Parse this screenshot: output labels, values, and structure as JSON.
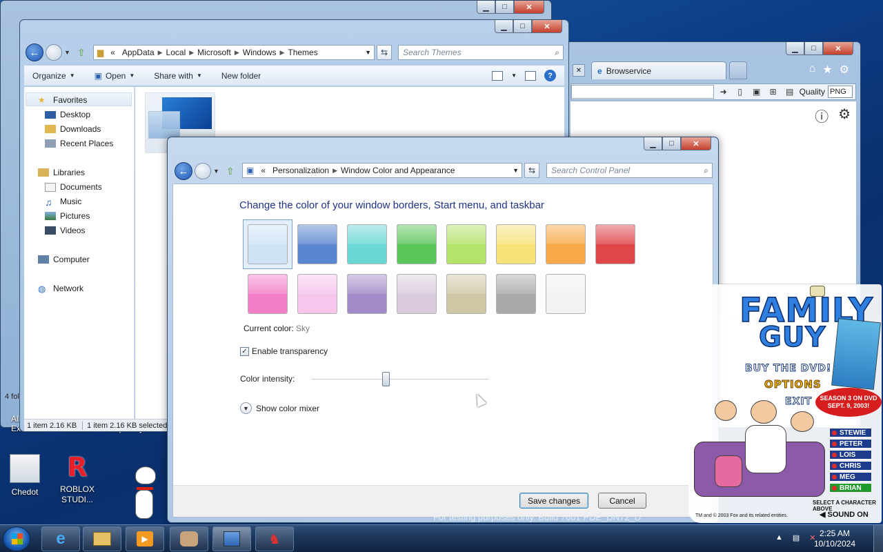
{
  "explorer": {
    "breadcrumb": [
      "AppData",
      "Local",
      "Microsoft",
      "Windows",
      "Themes"
    ],
    "search_placeholder": "Search Themes",
    "commands": [
      "Organize",
      "Open",
      "Share with",
      "New folder"
    ],
    "nav": {
      "favorites": "Favorites",
      "desktop": "Desktop",
      "downloads": "Downloads",
      "recent": "Recent Places",
      "libraries": "Libraries",
      "documents": "Documents",
      "music": "Music",
      "pictures": "Pictures",
      "videos": "Videos",
      "computer": "Computer",
      "network": "Network"
    },
    "status_left": "1 item 2.16 KB",
    "status_right": "1 item 2.16 KB selected"
  },
  "back_window": {
    "status_fragment": "4 fol"
  },
  "browser": {
    "tab_title": "Browservice",
    "quality_label": "Quality",
    "quality_value": "PNG"
  },
  "control_panel": {
    "breadcrumb": [
      "Personalization",
      "Window Color and Appearance"
    ],
    "search_placeholder": "Search Control Panel",
    "heading": "Change the color of your window borders, Start menu, and taskbar",
    "swatches_row1": [
      "#cfe3f7",
      "#5a86cf",
      "#6ad8d4",
      "#5cc55a",
      "#b4e36a",
      "#f7e27a",
      "#f8aa4a",
      "#e0454a"
    ],
    "swatches_row2": [
      "#f27ec7",
      "#f6c6ec",
      "#a28ac8",
      "#d9cbdd",
      "#cfc6a6",
      "#a9a9a9",
      "#f2f2f2"
    ],
    "current_color_label": "Current color:",
    "current_color_value": "Sky",
    "transparency_label": "Enable transparency",
    "transparency_checked": "✓",
    "intensity_label": "Color intensity:",
    "intensity_value": 0.42,
    "mixer_label": "Show color mixer",
    "save_label": "Save changes",
    "cancel_label": "Cancel"
  },
  "desktop": {
    "icon1": "Chedot",
    "icon2_line1": "ROBLOX",
    "icon2_line2": "STUDI...",
    "partial1": "All",
    "partial2": "Extreme",
    "partial3": "STUDI...",
    "partial4": "Kaspersky T..."
  },
  "ad": {
    "title1": "FAMILY",
    "title2": "GUY",
    "buy": "BUY THE DVD!",
    "options": "OPTIONS",
    "exit": "EXIT",
    "season": "SEASON 3 ON DVD",
    "season_date": "SEPT. 9, 2003!",
    "characters": [
      "STEWIE",
      "PETER",
      "LOIS",
      "CHRIS",
      "MEG",
      "BRIAN"
    ],
    "select": "SELECT A CHARACTER ABOVE",
    "copyright": "TM and © 2003 Fox and its related entities.",
    "sound": "SOUND ON"
  },
  "watermark": "For testing purposes only. Build 7601.PDE_DN72_D",
  "taskbar": {
    "time": "2:25 AM",
    "date": "10/10/2024"
  }
}
